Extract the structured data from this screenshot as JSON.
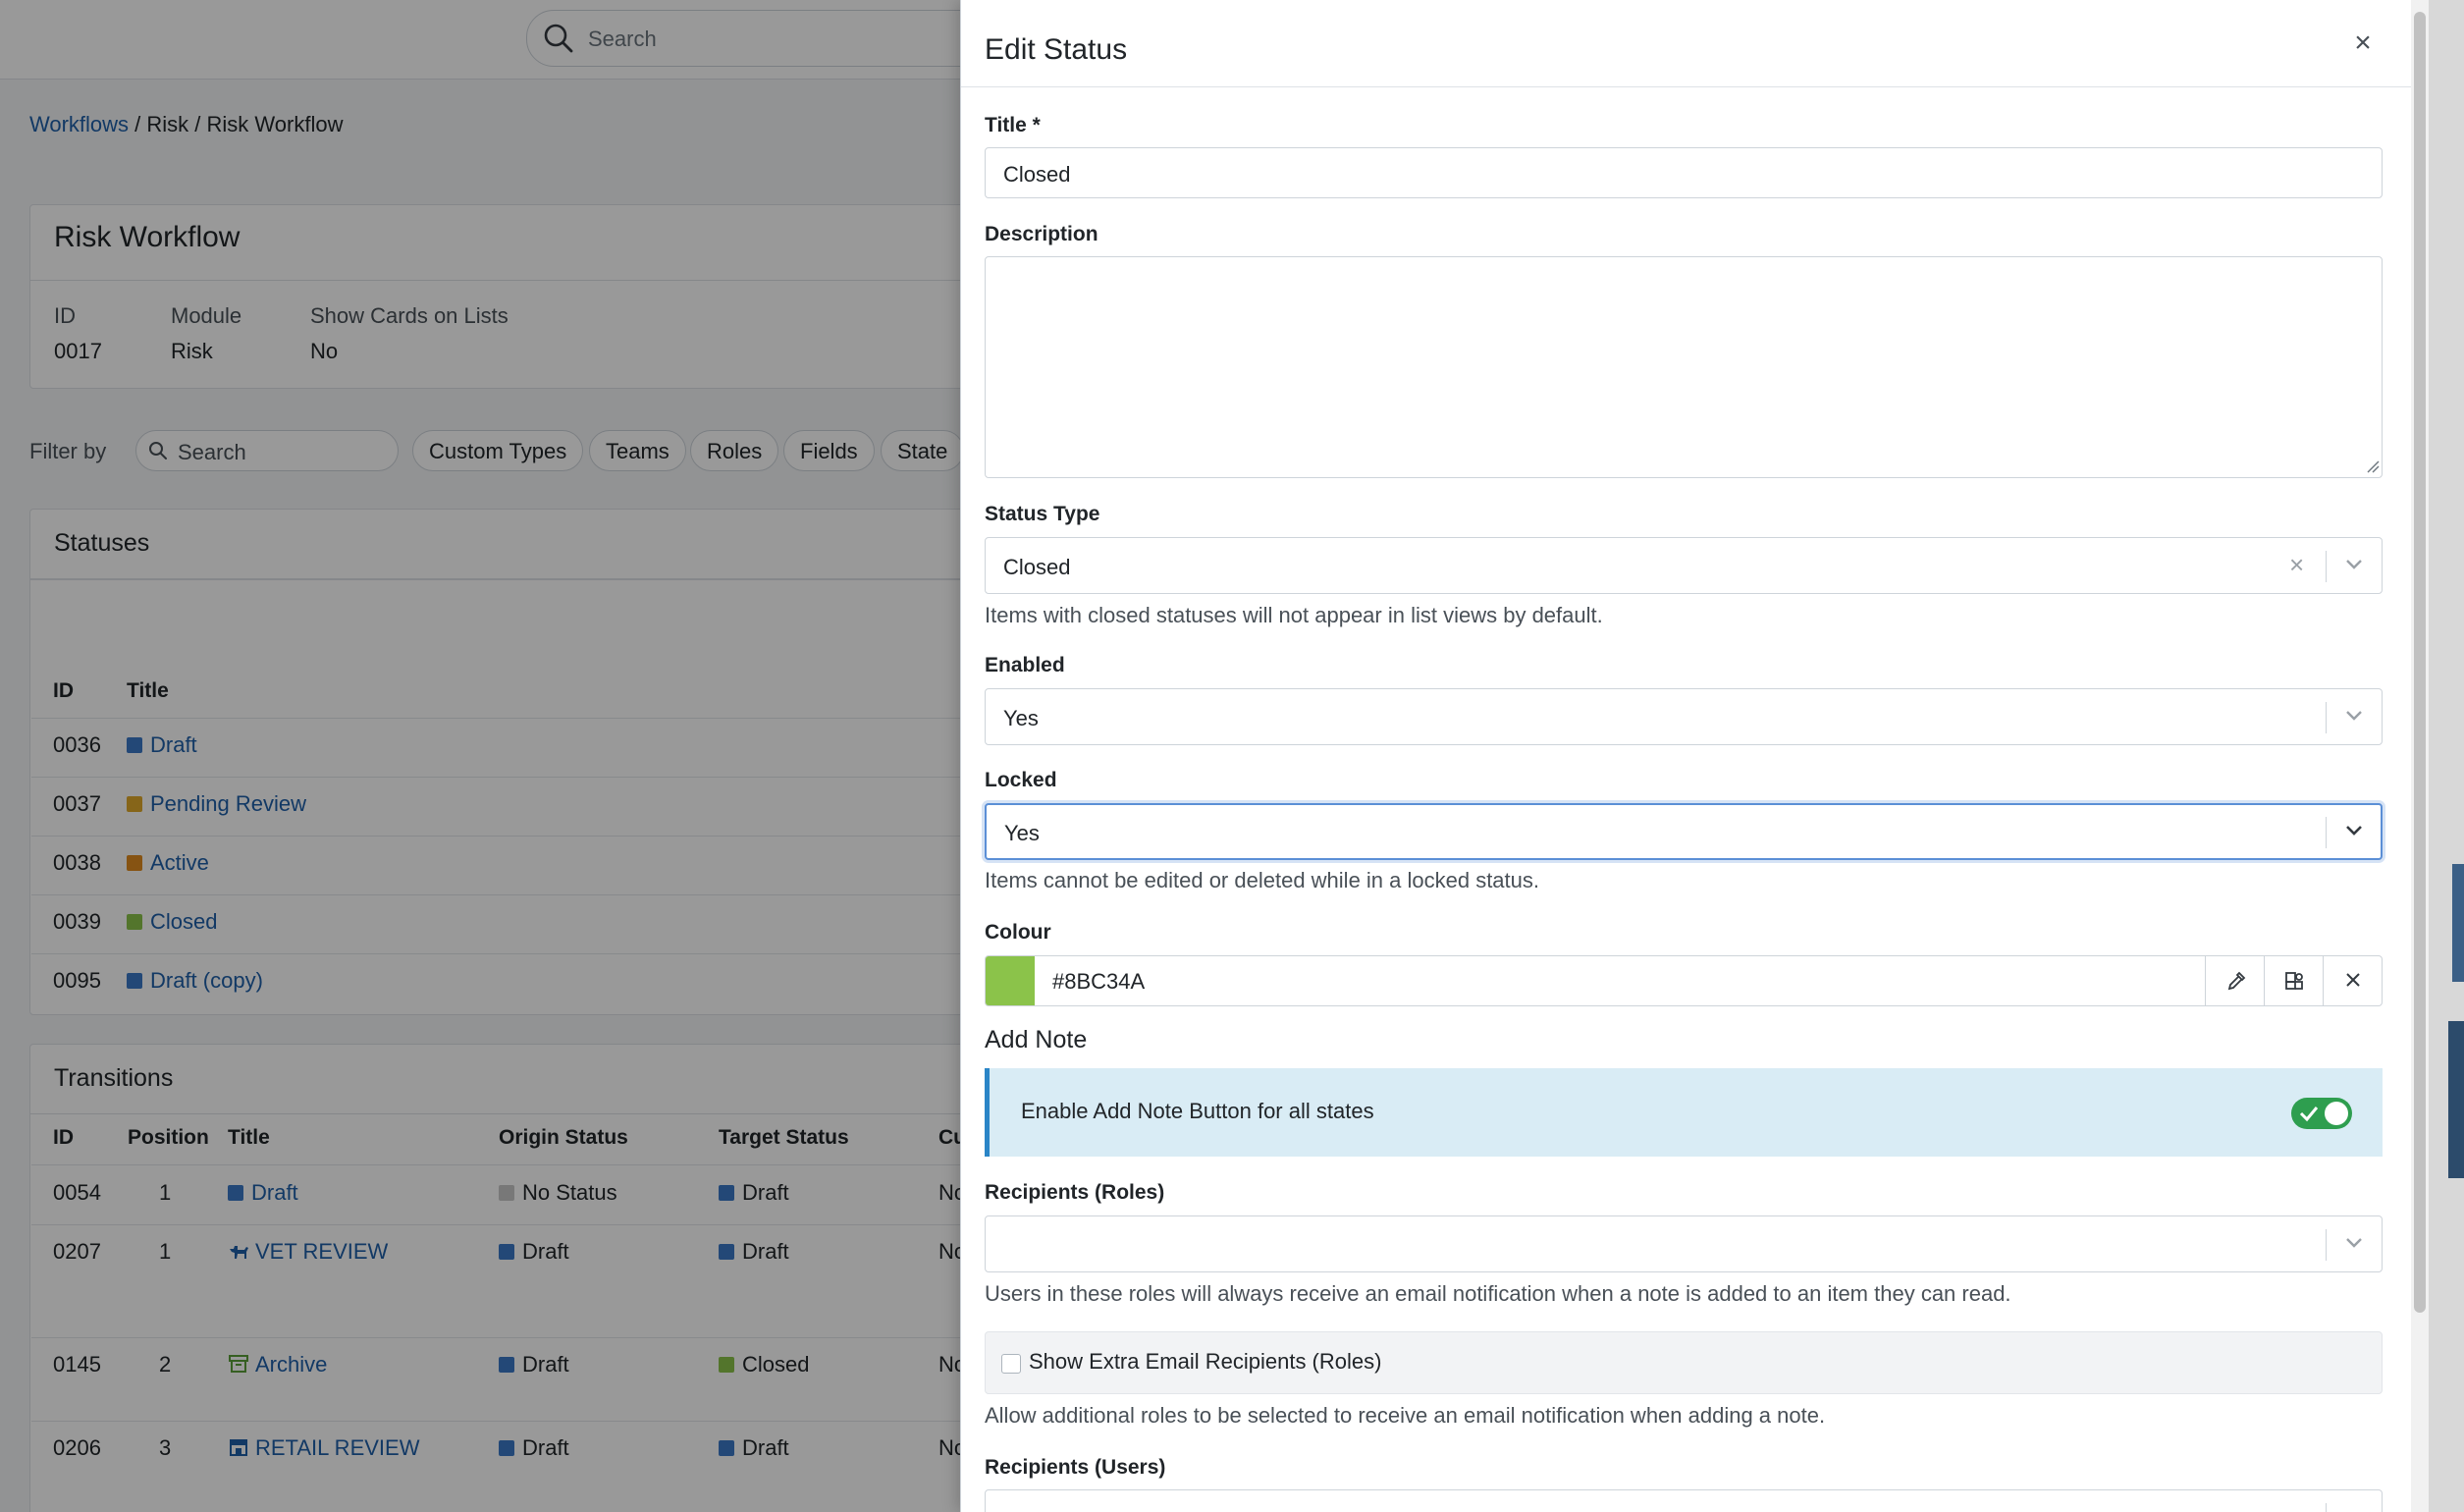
{
  "topbar": {
    "search_placeholder": "Search"
  },
  "breadcrumb": {
    "items": [
      "Workflows",
      "Risk",
      "Risk Workflow"
    ],
    "separator": " / "
  },
  "workflow": {
    "title": "Risk Workflow",
    "fields": [
      {
        "label": "ID",
        "value": "0017"
      },
      {
        "label": "Module",
        "value": "Risk"
      },
      {
        "label": "Show Cards on Lists",
        "value": "No"
      }
    ]
  },
  "filter": {
    "label": "Filter by",
    "search_placeholder": "Search",
    "pills": [
      "Custom Types",
      "Teams",
      "Roles",
      "Fields",
      "State"
    ]
  },
  "statuses": {
    "title": "Statuses",
    "columns": [
      "ID",
      "Title"
    ],
    "rows": [
      {
        "id": "0036",
        "title": "Draft",
        "color": "#3b78c6"
      },
      {
        "id": "0037",
        "title": "Pending Review",
        "color": "#e0a92a"
      },
      {
        "id": "0038",
        "title": "Active",
        "color": "#e08a1e"
      },
      {
        "id": "0039",
        "title": "Closed",
        "color": "#8bc34a"
      },
      {
        "id": "0095",
        "title": "Draft (copy)",
        "color": "#3b78c6"
      }
    ]
  },
  "transitions": {
    "title": "Transitions",
    "columns": [
      "ID",
      "Position",
      "Title",
      "Origin Status",
      "Target Status",
      "Cu"
    ],
    "rows": [
      {
        "id": "0054",
        "position": "1",
        "title": "Draft",
        "icon": "square-icon",
        "origin": "No Status",
        "origin_color": "#c8c8c8",
        "target": "Draft",
        "target_color": "#3b78c6",
        "extra": "No"
      },
      {
        "id": "0207",
        "position": "1",
        "title": "VET REVIEW",
        "icon": "dog-icon",
        "origin": "Draft",
        "origin_color": "#3b78c6",
        "target": "Draft",
        "target_color": "#3b78c6",
        "extra": "No"
      },
      {
        "id": "0145",
        "position": "2",
        "title": "Archive",
        "icon": "archive-icon",
        "origin": "Draft",
        "origin_color": "#3b78c6",
        "target": "Closed",
        "target_color": "#8bc34a",
        "extra": "No"
      },
      {
        "id": "0206",
        "position": "3",
        "title": "RETAIL REVIEW",
        "icon": "store-icon",
        "origin": "Draft",
        "origin_color": "#3b78c6",
        "target": "Draft",
        "target_color": "#3b78c6",
        "extra": "No"
      }
    ]
  },
  "panel": {
    "title": "Edit Status",
    "close_label": "×",
    "title_field": {
      "label": "Title *",
      "value": "Closed"
    },
    "description_field": {
      "label": "Description",
      "value": ""
    },
    "status_type": {
      "label": "Status Type",
      "value": "Closed",
      "help": "Items with closed statuses will not appear in list views by default."
    },
    "enabled": {
      "label": "Enabled",
      "value": "Yes"
    },
    "locked": {
      "label": "Locked",
      "value": "Yes",
      "help": "Items cannot be edited or deleted while in a locked status."
    },
    "colour": {
      "label": "Colour",
      "value": "#8BC34A",
      "swatch": "#8bc34a"
    },
    "add_note": {
      "heading": "Add Note",
      "toggle_label": "Enable Add Note Button for all states",
      "enabled": true
    },
    "recipients_roles": {
      "label": "Recipients (Roles)",
      "value": "",
      "help": "Users in these roles will always receive an email notification when a note is added to an item they can read."
    },
    "extra_recipients": {
      "label": "Show Extra Email Recipients (Roles)",
      "checked": false,
      "help": "Allow additional roles to be selected to receive an email notification when adding a note."
    },
    "recipients_users": {
      "label": "Recipients (Users)"
    }
  },
  "colors": {
    "accent": "#1f5fa8",
    "toggle_on": "#2e9e4f",
    "note_bg": "#d9ecf5"
  }
}
